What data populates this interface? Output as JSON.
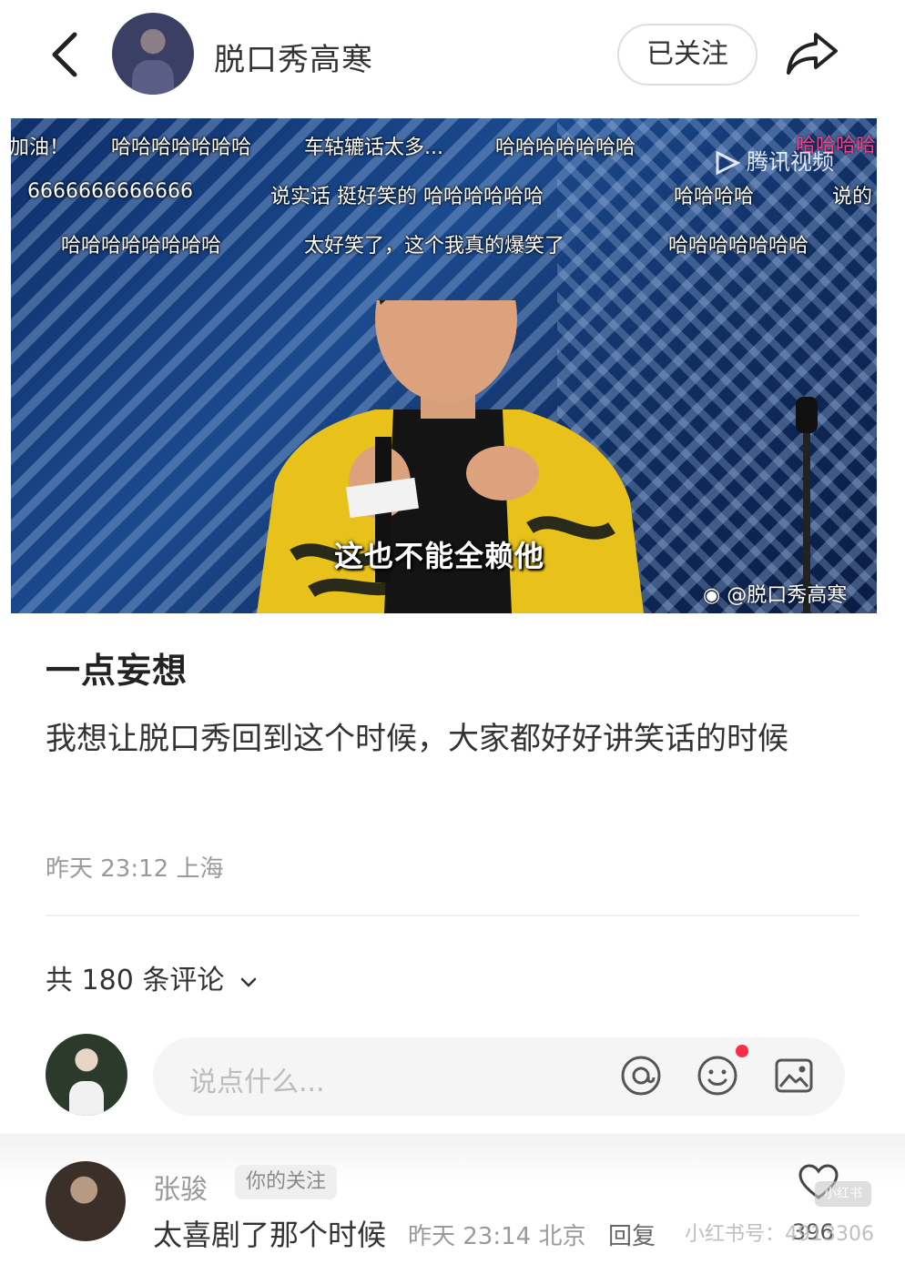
{
  "header": {
    "author_name": "脱口秀高寒",
    "follow_label": "已关注"
  },
  "video": {
    "danmu": [
      "加油！",
      "哈哈哈哈哈哈哈",
      "车轱辘话太多...",
      "哈哈哈哈哈哈哈",
      "哈哈哈哈",
      "6666666666666",
      "说实话 挺好笑的 哈哈哈哈哈哈",
      "哈哈哈哈",
      "说的",
      "哈哈哈哈哈哈哈哈",
      "太好笑了，这个我真的爆笑了",
      "哈哈哈哈哈哈哈"
    ],
    "watermark_tencent": "腾讯视频",
    "subtitle": "这也不能全赖他",
    "weibo_handle": "@脱口秀高寒"
  },
  "post": {
    "title": "一点妄想",
    "body": "我想让脱口秀回到这个时候，大家都好好讲笑话的时候",
    "meta": "昨天 23:12 上海"
  },
  "comments": {
    "count_label": "共 180 条评论",
    "input_placeholder": "说点什么...",
    "first": {
      "name": "张骏",
      "badge": "你的关注",
      "text": "太喜剧了那个时候",
      "meta": "昨天 23:14 北京",
      "reply_label": "回复",
      "likes": "396"
    }
  },
  "watermark": {
    "text": "小红书号：4913306",
    "logo": "小红书"
  },
  "colors": {
    "accent_red": "#ff2b4a",
    "danmu_pink": "#e8478b"
  }
}
